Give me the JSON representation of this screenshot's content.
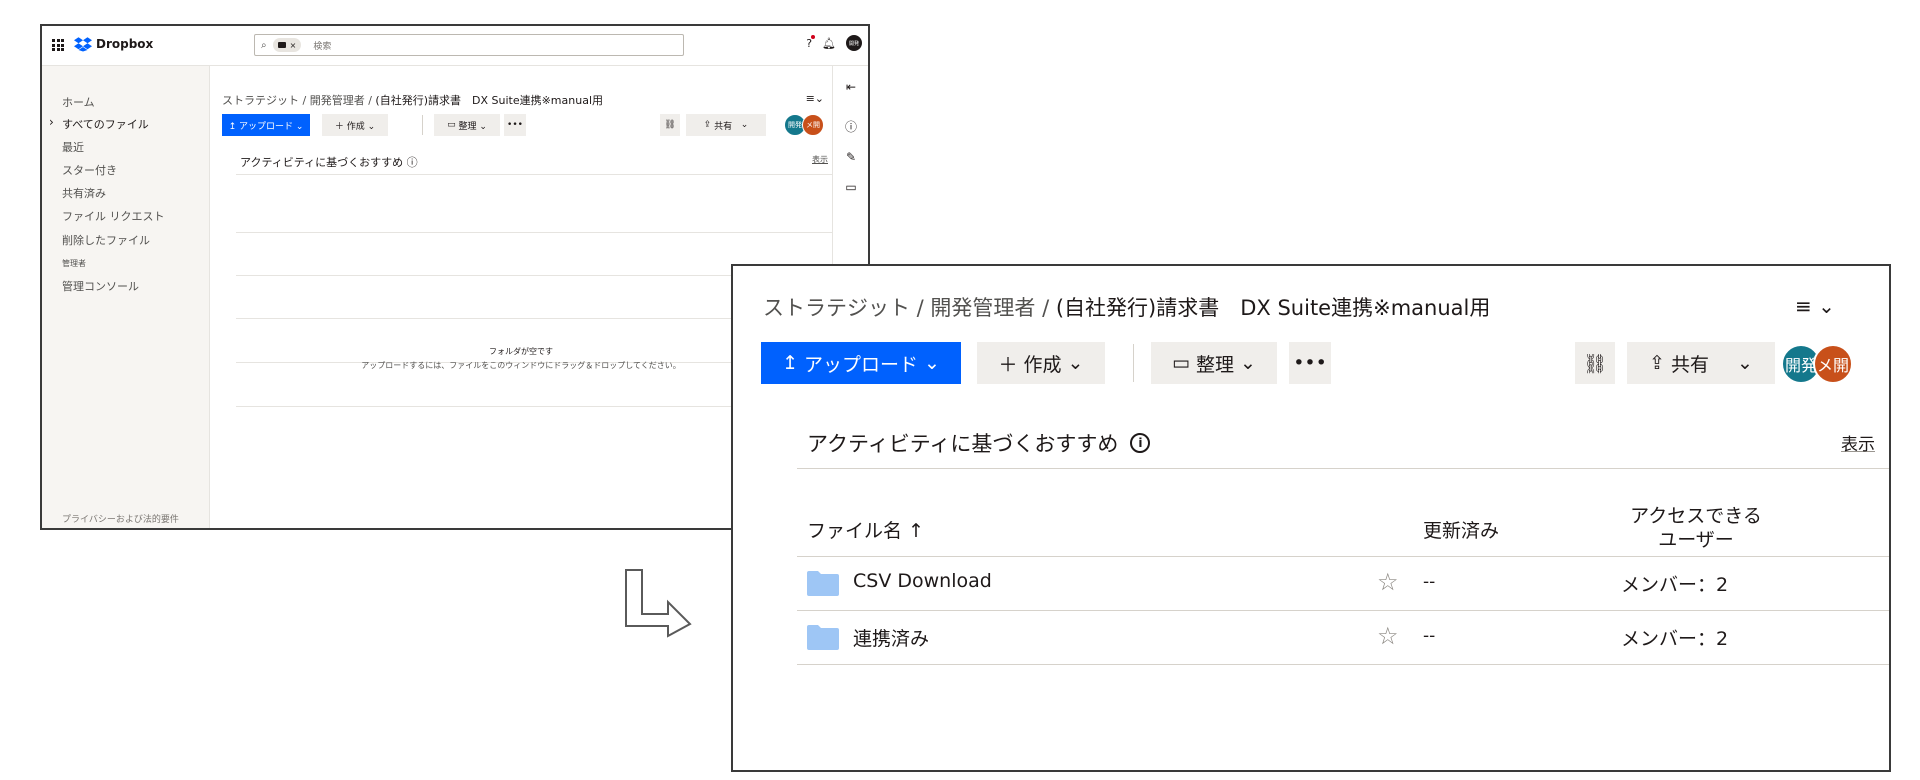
{
  "small_window": {
    "topbar": {
      "logo_text": "Dropbox",
      "search_placeholder": "検索",
      "search_chip_label": "×"
    },
    "sidebar": {
      "items": [
        {
          "label": "ホーム"
        },
        {
          "label": "すべてのファイル",
          "active": true
        },
        {
          "label": "最近"
        },
        {
          "label": "スター付き"
        },
        {
          "label": "共有済み"
        },
        {
          "label": "ファイル リクエスト"
        },
        {
          "label": "削除したファイル"
        },
        {
          "label": "管理者"
        },
        {
          "label": "管理コンソール"
        }
      ],
      "footer": "プライバシーおよび法的要件"
    },
    "breadcrumb": {
      "parts": "ストラテジット / 開発管理者 / ",
      "current": "(自社発行)請求書　DX Suite連携※manual用"
    },
    "toolbar": {
      "upload": "↥ アップロード ⌄",
      "create": "＋ 作成 ⌄",
      "organize": "整理 ⌄",
      "more": "•••",
      "share": "共有",
      "share_caret": "⌄"
    },
    "recommend_title": "アクティビティに基づくおすすめ",
    "recommend_show": "表示",
    "empty_title": "フォルダが空です",
    "empty_sub": "アップロードするには、ファイルをこのウィンドウにドラッグ＆ドロップしてください。",
    "avatars": [
      "開発",
      "メ開"
    ],
    "user_avatar": "開発"
  },
  "large_window": {
    "breadcrumb": {
      "parts": "ストラテジット / 開発管理者 / ",
      "current": "(自社発行)請求書　DX Suite連携※manual用"
    },
    "toolbar": {
      "upload": "アップロード",
      "create": "作成",
      "organize": "整理",
      "more": "•••",
      "share": "共有"
    },
    "avatars": [
      {
        "label": "開発",
        "color": "#14788c"
      },
      {
        "label": "メ開",
        "color": "#c8501a"
      }
    ],
    "recommend_title": "アクティビティに基づくおすすめ",
    "recommend_show": "表示",
    "table": {
      "columns": {
        "name": "ファイル名",
        "modified": "更新済み",
        "access_line1": "アクセスできる",
        "access_line2": "ユーザー"
      },
      "rows": [
        {
          "name": "CSV Download",
          "modified": "--",
          "access": "メンバー：2"
        },
        {
          "name": "連携済み",
          "modified": "--",
          "access": "メンバー：2"
        }
      ]
    }
  },
  "colors": {
    "primary": "#0061fe",
    "folder": "#9ec6f5"
  }
}
